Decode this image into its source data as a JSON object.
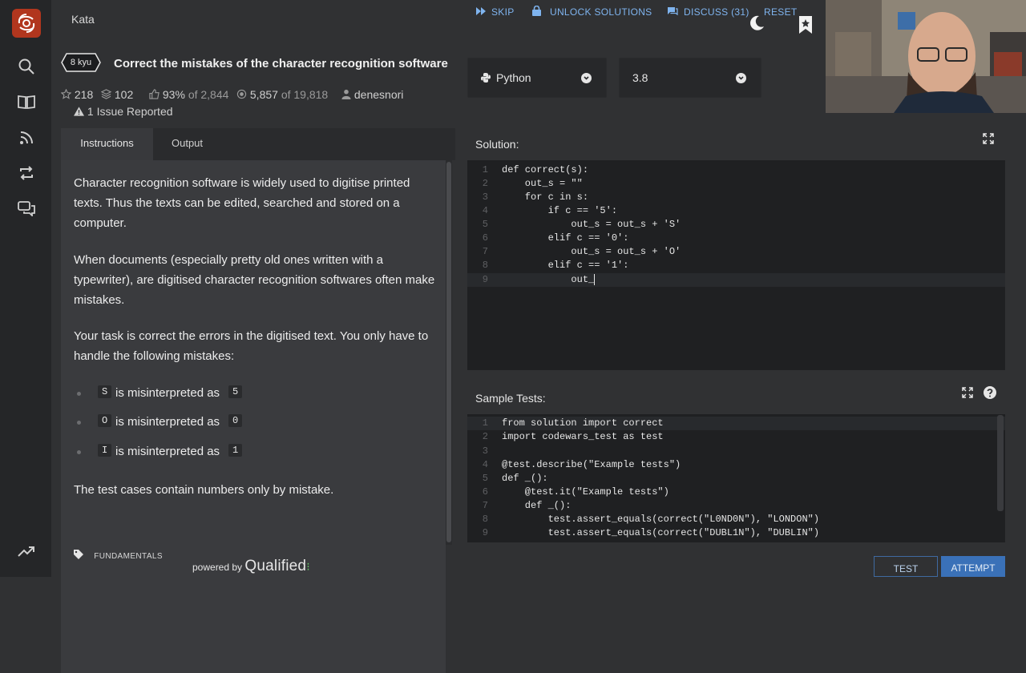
{
  "app": {
    "section": "Kata"
  },
  "kata": {
    "rank": "8 kyu",
    "title": "Correct the mistakes of the character recognition software",
    "stars": "218",
    "collections": "102",
    "satisfaction": "93%",
    "satisfaction_of": "of 2,844",
    "completed": "5,857",
    "completed_of": "of 19,818",
    "author": "denesnori",
    "issues": "1 Issue Reported"
  },
  "language": {
    "selected": "Python",
    "version": "3.8"
  },
  "tabs": [
    {
      "label": "Instructions",
      "active": true
    },
    {
      "label": "Output",
      "active": false
    }
  ],
  "instructions": {
    "para1": "Character recognition software is widely used to digitise printed texts. Thus the texts can be edited, searched and stored on a computer.",
    "para2": "When documents (especially pretty old ones written with a typewriter), are digitised character recognition softwares often make mistakes.",
    "para3": "Your task is correct the errors in the digitised text. You only have to handle the following mistakes:",
    "bullets": [
      {
        "from": "S",
        "text": "is misinterpreted as",
        "to": "5"
      },
      {
        "from": "O",
        "text": "is misinterpreted as",
        "to": "0"
      },
      {
        "from": "I",
        "text": "is misinterpreted as",
        "to": "1"
      }
    ],
    "para4": "The test cases contain numbers only by mistake.",
    "tag": "FUNDAMENTALS"
  },
  "footer": {
    "powered": "powered by",
    "brand": "Qualified"
  },
  "solution": {
    "title": "Solution:",
    "lines": [
      "def correct(s):",
      "    out_s = \"\"",
      "    for c in s:",
      "        if c == '5':",
      "            out_s = out_s + 'S'",
      "        elif c == '0':",
      "            out_s = out_s + 'O'",
      "        elif c == '1':",
      "            out_"
    ]
  },
  "tests": {
    "title": "Sample Tests:",
    "lines": [
      "from solution import correct",
      "import codewars_test as test",
      "",
      "@test.describe(\"Example tests\")",
      "def _():",
      "    @test.it(\"Example tests\")",
      "    def _():",
      "        test.assert_equals(correct(\"L0ND0N\"), \"LONDON\")",
      "        test.assert_equals(correct(\"DUBL1N\"), \"DUBLIN\")"
    ]
  },
  "actions": {
    "skip": "SKIP",
    "unlock": "UNLOCK SOLUTIONS",
    "discuss": "DISCUSS (31)",
    "reset": "RESET",
    "test": "TEST",
    "attempt": "ATTEMPT"
  },
  "colors": {
    "brand": "#b1361e",
    "accent": "#3a71b8",
    "link": "#7fb4ef"
  }
}
